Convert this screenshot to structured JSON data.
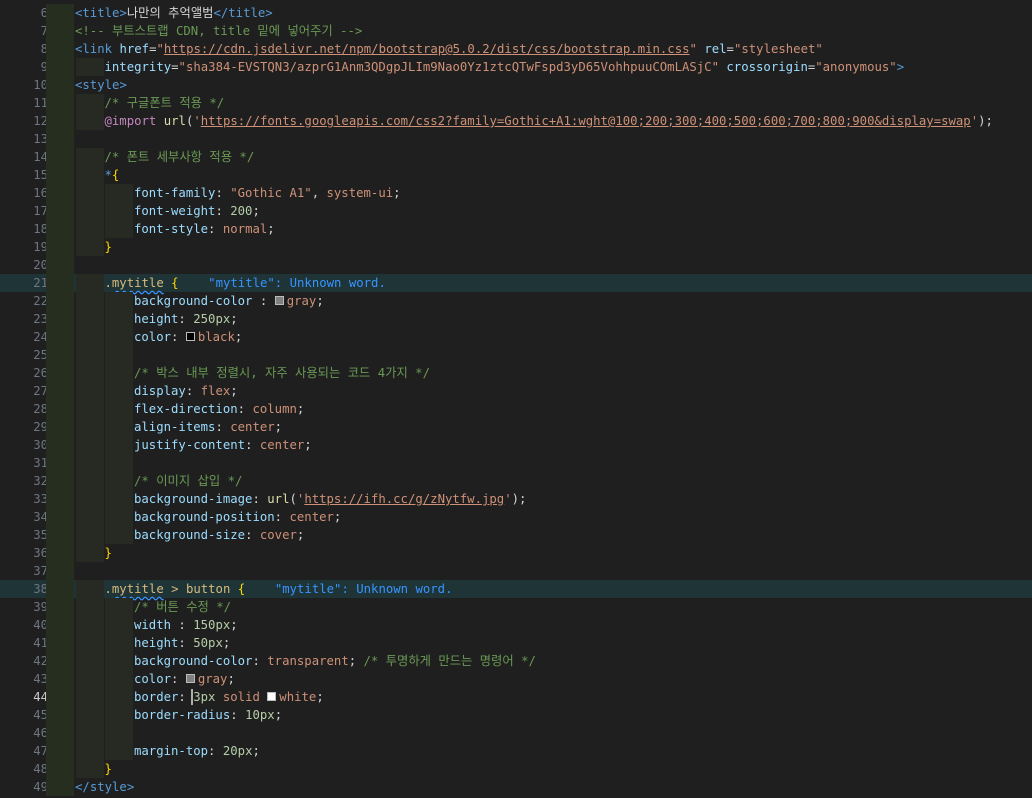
{
  "editor": {
    "active_line": 44,
    "highlighted_lines": [
      21,
      38
    ],
    "lines": [
      {
        "n": 6,
        "indent": 1,
        "tokens": [
          [
            "tag",
            "<"
          ],
          [
            "tagn",
            "title"
          ],
          [
            "tag",
            ">"
          ],
          [
            "text",
            "나만의 추억앨범"
          ],
          [
            "tag",
            "</"
          ],
          [
            "tagn",
            "title"
          ],
          [
            "tag",
            ">"
          ]
        ]
      },
      {
        "n": 7,
        "indent": 1,
        "tokens": [
          [
            "com",
            "<!-- 부트스트랩 CDN, title 밑에 넣어주기 -->"
          ]
        ]
      },
      {
        "n": 8,
        "indent": 1,
        "tokens": [
          [
            "tag",
            "<"
          ],
          [
            "tagn",
            "link"
          ],
          [
            "text",
            " "
          ],
          [
            "attr",
            "href"
          ],
          [
            "punc",
            "="
          ],
          [
            "str",
            "\""
          ],
          [
            "url",
            "https://cdn.jsdelivr.net/npm/bootstrap@5.0.2/dist/css/bootstrap.min.css"
          ],
          [
            "str",
            "\""
          ],
          [
            "text",
            " "
          ],
          [
            "attr",
            "rel"
          ],
          [
            "punc",
            "="
          ],
          [
            "str",
            "\"stylesheet\""
          ]
        ]
      },
      {
        "n": 9,
        "indent": 2,
        "tokens": [
          [
            "attr",
            "integrity"
          ],
          [
            "punc",
            "="
          ],
          [
            "str",
            "\"sha384-EVSTQN3/azprG1Anm3QDgpJLIm9Nao0Yz1ztcQTwFspd3yD65VohhpuuCOmLASjC\""
          ],
          [
            "text",
            " "
          ],
          [
            "attr",
            "crossorigin"
          ],
          [
            "punc",
            "="
          ],
          [
            "str",
            "\"anonymous\""
          ],
          [
            "tag",
            ">"
          ]
        ]
      },
      {
        "n": 10,
        "indent": 1,
        "tokens": [
          [
            "tag",
            "<"
          ],
          [
            "tagn",
            "style"
          ],
          [
            "tag",
            ">"
          ]
        ]
      },
      {
        "n": 11,
        "indent": 2,
        "tokens": [
          [
            "com",
            "/* 구글폰트 적용 */"
          ]
        ]
      },
      {
        "n": 12,
        "indent": 2,
        "tokens": [
          [
            "kw",
            "@import"
          ],
          [
            "text",
            " "
          ],
          [
            "fn",
            "url"
          ],
          [
            "punc",
            "("
          ],
          [
            "str",
            "'"
          ],
          [
            "url",
            "https://fonts.googleapis.com/css2?family=Gothic+A1:wght@100;200;300;400;500;600;700;800;900&display=swap"
          ],
          [
            "str",
            "'"
          ],
          [
            "punc",
            ");"
          ]
        ]
      },
      {
        "n": 13,
        "indent": 1,
        "tokens": []
      },
      {
        "n": 14,
        "indent": 2,
        "tokens": [
          [
            "com",
            "/* 폰트 세부사항 적용 */"
          ]
        ]
      },
      {
        "n": 15,
        "indent": 2,
        "tokens": [
          [
            "star",
            "*"
          ],
          [
            "brace",
            "{"
          ]
        ]
      },
      {
        "n": 16,
        "indent": 3,
        "tokens": [
          [
            "prop",
            "font-family"
          ],
          [
            "punc",
            ": "
          ],
          [
            "str",
            "\"Gothic A1\""
          ],
          [
            "punc",
            ", "
          ],
          [
            "val",
            "system-ui"
          ],
          [
            "punc",
            ";"
          ]
        ]
      },
      {
        "n": 17,
        "indent": 3,
        "tokens": [
          [
            "prop",
            "font-weight"
          ],
          [
            "punc",
            ": "
          ],
          [
            "num",
            "200"
          ],
          [
            "punc",
            ";"
          ]
        ]
      },
      {
        "n": 18,
        "indent": 3,
        "tokens": [
          [
            "prop",
            "font-style"
          ],
          [
            "punc",
            ": "
          ],
          [
            "val",
            "normal"
          ],
          [
            "punc",
            ";"
          ]
        ]
      },
      {
        "n": 19,
        "indent": 2,
        "tokens": [
          [
            "brace",
            "}"
          ]
        ]
      },
      {
        "n": 20,
        "indent": 1,
        "tokens": []
      },
      {
        "n": 21,
        "indent": 2,
        "tokens": [
          [
            "sel",
            "."
          ],
          [
            "selsq",
            "mytitle"
          ],
          [
            "text",
            " "
          ],
          [
            "brace",
            "{"
          ],
          [
            "text",
            "    "
          ],
          [
            "diag",
            "\"mytitle\": Unknown word."
          ]
        ]
      },
      {
        "n": 22,
        "indent": 3,
        "tokens": [
          [
            "prop",
            "background-color"
          ],
          [
            "punc",
            " : "
          ],
          [
            "swatch",
            "#808080"
          ],
          [
            "val",
            "gray"
          ],
          [
            "punc",
            ";"
          ]
        ]
      },
      {
        "n": 23,
        "indent": 3,
        "tokens": [
          [
            "prop",
            "height"
          ],
          [
            "punc",
            ": "
          ],
          [
            "num",
            "250px"
          ],
          [
            "punc",
            ";"
          ]
        ]
      },
      {
        "n": 24,
        "indent": 3,
        "tokens": [
          [
            "prop",
            "color"
          ],
          [
            "punc",
            ": "
          ],
          [
            "swatch",
            "#000000"
          ],
          [
            "val",
            "black"
          ],
          [
            "punc",
            ";"
          ]
        ]
      },
      {
        "n": 25,
        "indent": 3,
        "tokens": []
      },
      {
        "n": 26,
        "indent": 3,
        "tokens": [
          [
            "com",
            "/* 박스 내부 정렬시, 자주 사용되는 코드 4가지 */"
          ]
        ]
      },
      {
        "n": 27,
        "indent": 3,
        "tokens": [
          [
            "prop",
            "display"
          ],
          [
            "punc",
            ": "
          ],
          [
            "val",
            "flex"
          ],
          [
            "punc",
            ";"
          ]
        ]
      },
      {
        "n": 28,
        "indent": 3,
        "tokens": [
          [
            "prop",
            "flex-direction"
          ],
          [
            "punc",
            ": "
          ],
          [
            "val",
            "column"
          ],
          [
            "punc",
            ";"
          ]
        ]
      },
      {
        "n": 29,
        "indent": 3,
        "tokens": [
          [
            "prop",
            "align-items"
          ],
          [
            "punc",
            ": "
          ],
          [
            "val",
            "center"
          ],
          [
            "punc",
            ";"
          ]
        ]
      },
      {
        "n": 30,
        "indent": 3,
        "tokens": [
          [
            "prop",
            "justify-content"
          ],
          [
            "punc",
            ": "
          ],
          [
            "val",
            "center"
          ],
          [
            "punc",
            ";"
          ]
        ]
      },
      {
        "n": 31,
        "indent": 3,
        "tokens": []
      },
      {
        "n": 32,
        "indent": 3,
        "tokens": [
          [
            "com",
            "/* 이미지 삽입 */"
          ]
        ]
      },
      {
        "n": 33,
        "indent": 3,
        "tokens": [
          [
            "prop",
            "background-image"
          ],
          [
            "punc",
            ": "
          ],
          [
            "fn",
            "url"
          ],
          [
            "punc",
            "("
          ],
          [
            "str",
            "'"
          ],
          [
            "url",
            "https://ifh.cc/g/zNytfw.jpg"
          ],
          [
            "str",
            "'"
          ],
          [
            "punc",
            ");"
          ]
        ]
      },
      {
        "n": 34,
        "indent": 3,
        "tokens": [
          [
            "prop",
            "background-position"
          ],
          [
            "punc",
            ": "
          ],
          [
            "val",
            "center"
          ],
          [
            "punc",
            ";"
          ]
        ]
      },
      {
        "n": 35,
        "indent": 3,
        "tokens": [
          [
            "prop",
            "background-size"
          ],
          [
            "punc",
            ": "
          ],
          [
            "val",
            "cover"
          ],
          [
            "punc",
            ";"
          ]
        ]
      },
      {
        "n": 36,
        "indent": 2,
        "tokens": [
          [
            "brace",
            "}"
          ]
        ]
      },
      {
        "n": 37,
        "indent": 1,
        "tokens": []
      },
      {
        "n": 38,
        "indent": 2,
        "tokens": [
          [
            "sel",
            "."
          ],
          [
            "selsq",
            "mytitle"
          ],
          [
            "sel",
            " > button "
          ],
          [
            "brace",
            "{"
          ],
          [
            "text",
            "    "
          ],
          [
            "diag",
            "\"mytitle\": Unknown word."
          ]
        ]
      },
      {
        "n": 39,
        "indent": 3,
        "tokens": [
          [
            "com",
            "/* 버튼 수정 */"
          ]
        ]
      },
      {
        "n": 40,
        "indent": 3,
        "tokens": [
          [
            "prop",
            "width"
          ],
          [
            "punc",
            " : "
          ],
          [
            "num",
            "150px"
          ],
          [
            "punc",
            ";"
          ]
        ]
      },
      {
        "n": 41,
        "indent": 3,
        "tokens": [
          [
            "prop",
            "height"
          ],
          [
            "punc",
            ": "
          ],
          [
            "num",
            "50px"
          ],
          [
            "punc",
            ";"
          ]
        ]
      },
      {
        "n": 42,
        "indent": 3,
        "tokens": [
          [
            "prop",
            "background-color"
          ],
          [
            "punc",
            ": "
          ],
          [
            "val",
            "transparent"
          ],
          [
            "punc",
            "; "
          ],
          [
            "com",
            "/* 투명하게 만드는 명령어 */"
          ]
        ]
      },
      {
        "n": 43,
        "indent": 3,
        "tokens": [
          [
            "prop",
            "color"
          ],
          [
            "punc",
            ": "
          ],
          [
            "swatch",
            "#808080"
          ],
          [
            "val",
            "gray"
          ],
          [
            "punc",
            ";"
          ]
        ]
      },
      {
        "n": 44,
        "indent": 3,
        "tokens": [
          [
            "prop",
            "border"
          ],
          [
            "punc",
            ": "
          ],
          [
            "num",
            "3px"
          ],
          [
            "text",
            " "
          ],
          [
            "val",
            "solid"
          ],
          [
            "text",
            " "
          ],
          [
            "swatch",
            "#ffffff"
          ],
          [
            "val",
            "white"
          ],
          [
            "punc",
            ";"
          ]
        ]
      },
      {
        "n": 45,
        "indent": 3,
        "tokens": [
          [
            "prop",
            "border-radius"
          ],
          [
            "punc",
            ": "
          ],
          [
            "num",
            "10px"
          ],
          [
            "punc",
            ";"
          ]
        ]
      },
      {
        "n": 46,
        "indent": 3,
        "tokens": []
      },
      {
        "n": 47,
        "indent": 3,
        "tokens": [
          [
            "prop",
            "margin-top"
          ],
          [
            "punc",
            ": "
          ],
          [
            "num",
            "20px"
          ],
          [
            "punc",
            ";"
          ]
        ]
      },
      {
        "n": 48,
        "indent": 2,
        "tokens": [
          [
            "brace",
            "}"
          ]
        ]
      },
      {
        "n": 49,
        "indent": 1,
        "tokens": [
          [
            "tag",
            "</"
          ],
          [
            "tagn",
            "style"
          ],
          [
            "tag",
            ">"
          ]
        ]
      }
    ]
  }
}
